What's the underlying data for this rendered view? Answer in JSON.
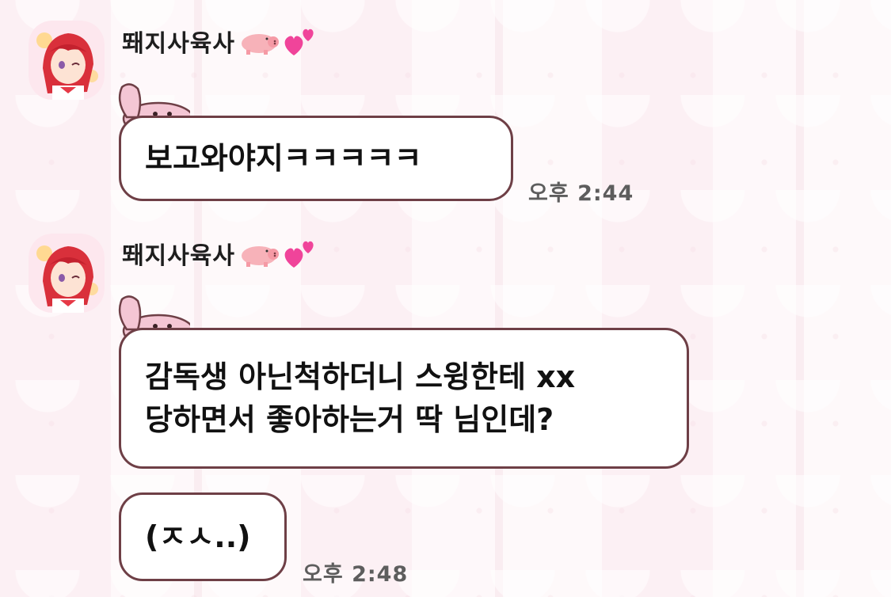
{
  "messages": [
    {
      "sender_name": "뙈지사육사",
      "sender_emojis": [
        "pig-emoji",
        "two-hearts-emoji"
      ],
      "text": "보고와야지ㅋㅋㅋㅋㅋ",
      "time": "오후 2:44"
    },
    {
      "sender_name": "뙈지사육사",
      "sender_emojis": [
        "pig-emoji",
        "two-hearts-emoji"
      ],
      "text": "감독생 아닌척하더니 스윙한테 xx\n당하면서 좋아하는거 딱 님인데?",
      "time": ""
    },
    {
      "sender_name": "",
      "text": "(ㅈㅅ..)",
      "time": "오후 2:48"
    }
  ],
  "colors": {
    "bubble_border": "#6e3f46",
    "bubble_fill": "#ffffff",
    "wallpaper": "#fbe9ef",
    "mascot_pink": "#f4c6d4",
    "time_text": "#5d5d5d"
  }
}
